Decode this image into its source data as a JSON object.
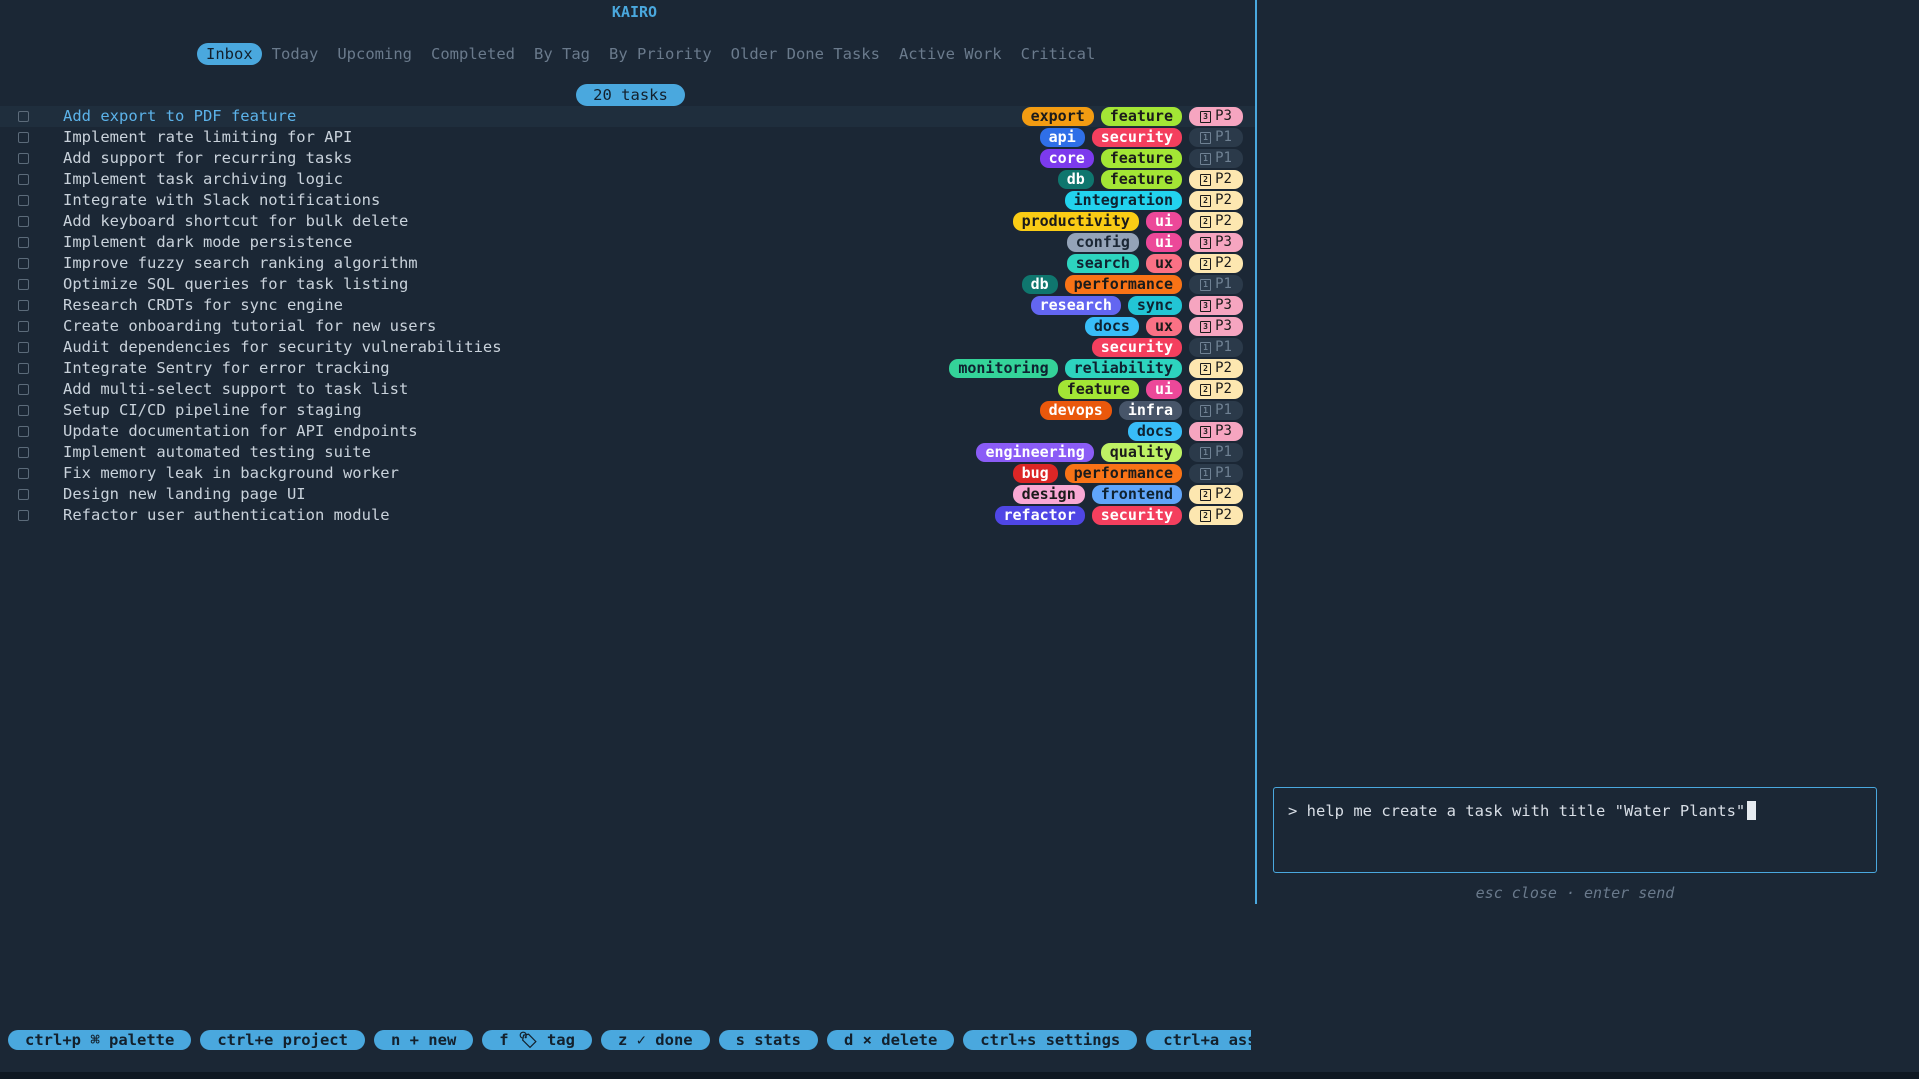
{
  "app": {
    "title": "KAIRO"
  },
  "tabs": [
    {
      "label": "Inbox",
      "active": true
    },
    {
      "label": "Today",
      "active": false
    },
    {
      "label": "Upcoming",
      "active": false
    },
    {
      "label": "Completed",
      "active": false
    },
    {
      "label": "By Tag",
      "active": false
    },
    {
      "label": "By Priority",
      "active": false
    },
    {
      "label": "Older Done Tasks",
      "active": false
    },
    {
      "label": "Active Work",
      "active": false
    },
    {
      "label": "Critical",
      "active": false
    }
  ],
  "task_count": "20 tasks",
  "tag_colors": {
    "export": "#f39c12",
    "feature": "#a3e635",
    "api": "#2f6fe8",
    "security": "#f43f5e",
    "core": "#7c3aed",
    "db": "#0f766e",
    "integration": "#22d3ee",
    "productivity": "#facc15",
    "ui": "#ec4899",
    "config": "#94a3b8",
    "search": "#2dd4bf",
    "ux": "#fb7185",
    "performance": "#f97316",
    "research": "#6366f1",
    "sync": "#22c5d5",
    "docs": "#38bdf8",
    "monitoring": "#34d399",
    "reliability": "#2dd4bf",
    "devops": "#ea580c",
    "infra": "#475569",
    "engineering": "#8b5cf6",
    "quality": "#bef264",
    "bug": "#dc2626",
    "design": "#f9a8d4",
    "frontend": "#60a5fa",
    "refactor": "#4f46e5"
  },
  "tag_text_colors": {
    "export": "#1b1b1b",
    "feature": "#1b1b1b",
    "api": "#ffffff",
    "security": "#ffffff",
    "core": "#ffffff",
    "db": "#ffffff",
    "integration": "#0f2230",
    "productivity": "#1b1b1b",
    "ui": "#ffffff",
    "config": "#1b2735",
    "search": "#0f2230",
    "ux": "#1b1b1b",
    "performance": "#1b1b1b",
    "research": "#ffffff",
    "sync": "#0f2230",
    "docs": "#0f2230",
    "monitoring": "#0f2230",
    "reliability": "#0f2230",
    "devops": "#ffffff",
    "infra": "#ffffff",
    "engineering": "#ffffff",
    "quality": "#1b1b1b",
    "bug": "#ffffff",
    "design": "#1b1b1b",
    "frontend": "#0f2230",
    "refactor": "#ffffff"
  },
  "priority_styles": {
    "P1": {
      "bg": "#2b3a4a",
      "fg": "#6f8193",
      "icon": "1"
    },
    "P2": {
      "bg": "#fde7b0",
      "fg": "#1b1b1b",
      "icon": "2"
    },
    "P3": {
      "bg": "#f6a5c0",
      "fg": "#1b1b1b",
      "icon": "3"
    }
  },
  "tasks": [
    {
      "title": "Add export to PDF feature",
      "tags": [
        "export",
        "feature"
      ],
      "priority": "P3",
      "selected": true
    },
    {
      "title": "Implement rate limiting for API",
      "tags": [
        "api",
        "security"
      ],
      "priority": "P1"
    },
    {
      "title": "Add support for recurring tasks",
      "tags": [
        "core",
        "feature"
      ],
      "priority": "P1"
    },
    {
      "title": "Implement task archiving logic",
      "tags": [
        "db",
        "feature"
      ],
      "priority": "P2"
    },
    {
      "title": "Integrate with Slack notifications",
      "tags": [
        "integration"
      ],
      "priority": "P2"
    },
    {
      "title": "Add keyboard shortcut for bulk delete",
      "tags": [
        "productivity",
        "ui"
      ],
      "priority": "P2"
    },
    {
      "title": "Implement dark mode persistence",
      "tags": [
        "config",
        "ui"
      ],
      "priority": "P3"
    },
    {
      "title": "Improve fuzzy search ranking algorithm",
      "tags": [
        "search",
        "ux"
      ],
      "priority": "P2"
    },
    {
      "title": "Optimize SQL queries for task listing",
      "tags": [
        "db",
        "performance"
      ],
      "priority": "P1"
    },
    {
      "title": "Research CRDTs for sync engine",
      "tags": [
        "research",
        "sync"
      ],
      "priority": "P3"
    },
    {
      "title": "Create onboarding tutorial for new users",
      "tags": [
        "docs",
        "ux"
      ],
      "priority": "P3"
    },
    {
      "title": "Audit dependencies for security vulnerabilities",
      "tags": [
        "security"
      ],
      "priority": "P1"
    },
    {
      "title": "Integrate Sentry for error tracking",
      "tags": [
        "monitoring",
        "reliability"
      ],
      "priority": "P2"
    },
    {
      "title": "Add multi-select support to task list",
      "tags": [
        "feature",
        "ui"
      ],
      "priority": "P2"
    },
    {
      "title": "Setup CI/CD pipeline for staging",
      "tags": [
        "devops",
        "infra"
      ],
      "priority": "P1"
    },
    {
      "title": "Update documentation for API endpoints",
      "tags": [
        "docs"
      ],
      "priority": "P3"
    },
    {
      "title": "Implement automated testing suite",
      "tags": [
        "engineering",
        "quality"
      ],
      "priority": "P1"
    },
    {
      "title": "Fix memory leak in background worker",
      "tags": [
        "bug",
        "performance"
      ],
      "priority": "P1"
    },
    {
      "title": "Design new landing page UI",
      "tags": [
        "design",
        "frontend"
      ],
      "priority": "P2"
    },
    {
      "title": "Refactor user authentication module",
      "tags": [
        "refactor",
        "security"
      ],
      "priority": "P2"
    }
  ],
  "assistant": {
    "input_value": "> help me create a task with title \"Water Plants\"",
    "hint": "esc close · enter send"
  },
  "keybar": [
    "ctrl+p ⌘ palette",
    "ctrl+e project",
    "n + new",
    "f 🏷 tag",
    "z ✓ done",
    "s stats",
    "d × delete",
    "ctrl+s settings",
    "ctrl+a assistant"
  ]
}
